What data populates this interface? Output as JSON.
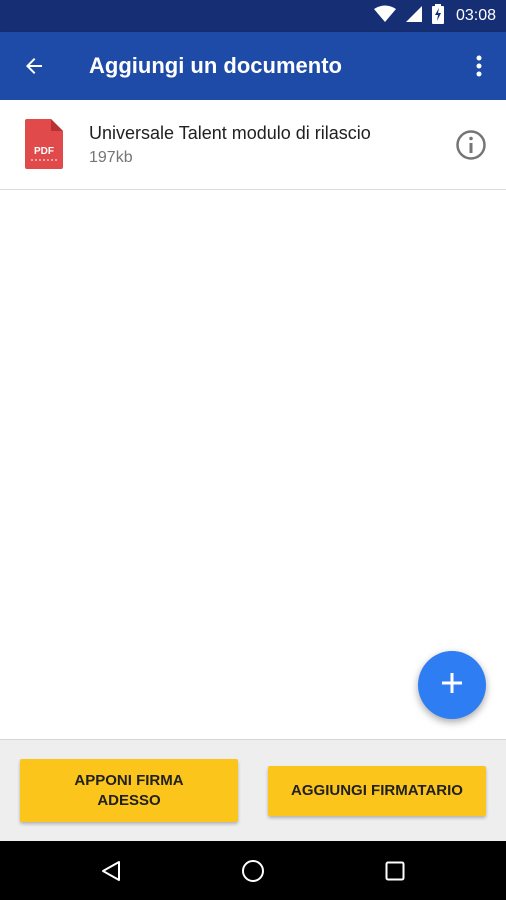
{
  "status_bar": {
    "time": "03:08",
    "icons": [
      "wifi-icon",
      "signal-icon",
      "battery-charging-icon"
    ]
  },
  "app_bar": {
    "title": "Aggiungi un documento",
    "back_icon": "arrow-back-icon",
    "menu_icon": "more-vert-icon"
  },
  "documents": [
    {
      "icon": "pdf-file-icon",
      "icon_label": "PDF",
      "name": "Universale Talent modulo di rilascio",
      "size": "197kb",
      "info_icon": "info-icon"
    }
  ],
  "fab": {
    "icon": "add-icon"
  },
  "actions": {
    "sign_now": "APPONI FIRMA ADESSO",
    "add_signer": "AGGIUNGI FIRMATARIO"
  },
  "nav_bar": {
    "icons": [
      "nav-back-icon",
      "nav-home-icon",
      "nav-recents-icon"
    ]
  },
  "colors": {
    "status_bar": "#162f74",
    "app_bar": "#1e4aa8",
    "fab": "#2f7df2",
    "button": "#fbc51b",
    "pdf_red": "#e04a4a"
  }
}
